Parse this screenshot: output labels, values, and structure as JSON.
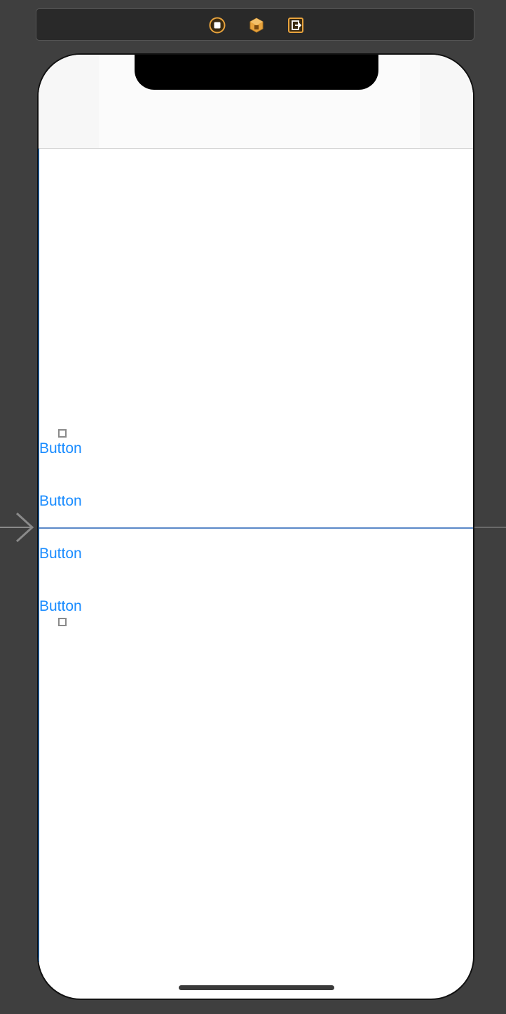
{
  "scene_dock": {
    "icons": [
      "view-controller-icon",
      "first-responder-icon",
      "exit-icon"
    ],
    "accent_color": "#e8a33d"
  },
  "canvas": {
    "background_color": "#3f3f3f",
    "entry_point": "storyboard-entry-arrow-icon"
  },
  "device": {
    "screen_color": "#ffffff",
    "buttons": [
      {
        "label": "Button"
      },
      {
        "label": "Button"
      },
      {
        "label": "Button"
      },
      {
        "label": "Button"
      }
    ],
    "button_color": "#1a8cff"
  }
}
